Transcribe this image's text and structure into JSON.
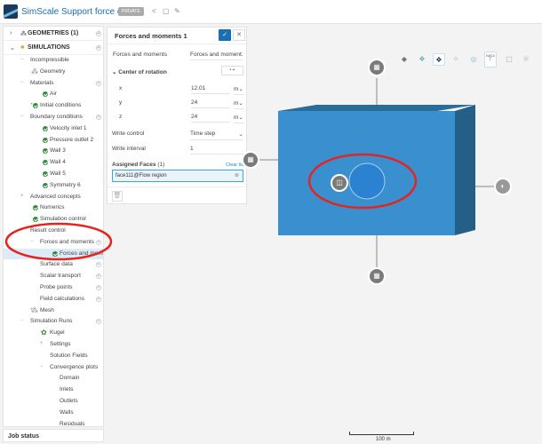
{
  "header": {
    "title": "SimScale Support force on ball",
    "badge": "PRIVATE"
  },
  "sidebar": {
    "geometries": "GEOMETRIES (1)",
    "simulations": "SIMULATIONS",
    "tree": [
      {
        "label": "Incompressible",
        "x": 30,
        "tog": "-"
      },
      {
        "label": "Geometry",
        "x": 41,
        "icon": "geometry"
      },
      {
        "label": "Materials",
        "x": 30,
        "tog": "-",
        "plus": true
      },
      {
        "label": "Air",
        "x": 52,
        "check": true
      },
      {
        "label": "Initial conditions",
        "x": 41,
        "check": true,
        "tog": "+"
      },
      {
        "label": "Boundary conditions",
        "x": 30,
        "tog": "-",
        "plus": true
      },
      {
        "label": "Velocity inlet 1",
        "x": 52,
        "check": true
      },
      {
        "label": "Pressure outlet 2",
        "x": 52,
        "check": true
      },
      {
        "label": "Wall 3",
        "x": 52,
        "check": true
      },
      {
        "label": "Wall 4",
        "x": 52,
        "check": true
      },
      {
        "label": "Wall 5",
        "x": 52,
        "check": true
      },
      {
        "label": "Symmetry 6",
        "x": 52,
        "check": true
      },
      {
        "label": "Advanced concepts",
        "x": 30,
        "tog": "+"
      },
      {
        "label": "Numerics",
        "x": 41,
        "check": true
      },
      {
        "label": "Simulation control",
        "x": 41,
        "check": true
      },
      {
        "label": "Result control",
        "x": 30,
        "tog": "-"
      },
      {
        "label": "Forces and moments",
        "x": 41,
        "tog": "-",
        "plus": true
      },
      {
        "label": "Forces and mom...",
        "x": 63,
        "check": true,
        "selected": true
      },
      {
        "label": "Surface data",
        "x": 41,
        "plus": true
      },
      {
        "label": "Scalar transport",
        "x": 41,
        "plus": true
      },
      {
        "label": "Probe points",
        "x": 41,
        "plus": true
      },
      {
        "label": "Field calculations",
        "x": 41,
        "plus": true
      },
      {
        "label": "Mesh",
        "x": 41,
        "icon": "mesh",
        "tog": "+"
      },
      {
        "label": "Simulation Runs",
        "x": 30,
        "tog": "-",
        "plus": true
      },
      {
        "label": "Kugel",
        "x": 52,
        "icon": "run",
        "tog": "-"
      },
      {
        "label": "Settings",
        "x": 52,
        "tog": "+"
      },
      {
        "label": "Solution Fields",
        "x": 52
      },
      {
        "label": "Convergence plots",
        "x": 52,
        "tog": "-"
      },
      {
        "label": "Domain",
        "x": 63
      },
      {
        "label": "Inlets",
        "x": 63
      },
      {
        "label": "Outlets",
        "x": 63
      },
      {
        "label": "Walls",
        "x": 63
      },
      {
        "label": "Residuals",
        "x": 63
      }
    ],
    "job_status": "Job status"
  },
  "panel": {
    "title": "Forces and moments 1",
    "type_label": "Forces and moments",
    "type_value": "Forces and moment:",
    "cor_label": "Center of rotation",
    "x_label": "x",
    "x_value": "12.01",
    "y_label": "y",
    "y_value": "24",
    "z_label": "z",
    "z_value": "24",
    "unit": "m",
    "write_control_label": "Write control",
    "write_control_value": "Time step",
    "write_interval_label": "Write interval",
    "write_interval_value": "1",
    "assigned_label": "Assigned Faces",
    "assigned_count": "(1)",
    "clear_list": "Clear list",
    "face": "face111@Flow region"
  },
  "viewport": {
    "beta": "BETA",
    "scale_label": "100 m"
  },
  "colors": {
    "accent": "#1a6fb0",
    "box_front": "#3a8fcf",
    "box_top": "#2a6d9c",
    "box_side": "#245f88",
    "annotation": "#e52420"
  }
}
